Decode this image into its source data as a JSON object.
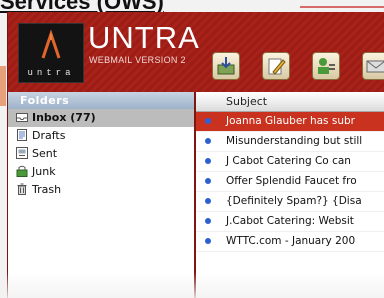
{
  "page_title": "Services (OWS)",
  "app": {
    "brand": "UNTRA",
    "brand_sub": "WEBMAIL VERSION 2",
    "logo_tag": "untra",
    "accent": "#a3201a"
  },
  "toolbar": {
    "buttons": [
      {
        "name": "get-mail-button",
        "icon": "inbox-download-icon"
      },
      {
        "name": "compose-button",
        "icon": "pencil-icon"
      },
      {
        "name": "address-book-button",
        "icon": "contacts-icon"
      },
      {
        "name": "send-button",
        "icon": "envelope-icon"
      }
    ]
  },
  "folders": {
    "heading": "Folders",
    "items": [
      {
        "label": "Inbox (77)",
        "icon": "inbox-icon",
        "selected": true
      },
      {
        "label": "Drafts",
        "icon": "drafts-icon"
      },
      {
        "label": "Sent",
        "icon": "sent-icon"
      },
      {
        "label": "Junk",
        "icon": "junk-icon"
      },
      {
        "label": "Trash",
        "icon": "trash-icon"
      }
    ]
  },
  "messages": {
    "column_header": "Subject",
    "rows": [
      {
        "subject": "Joanna Glauber has subr",
        "selected": true
      },
      {
        "subject": "Misunderstanding but still"
      },
      {
        "subject": "J Cabot Catering Co can"
      },
      {
        "subject": "Offer Splendid Faucet fro"
      },
      {
        "subject": "{Definitely Spam?} {Disa"
      },
      {
        "subject": "J.Cabot Catering: Websit"
      },
      {
        "subject": "WTTC.com - January 200"
      }
    ]
  }
}
